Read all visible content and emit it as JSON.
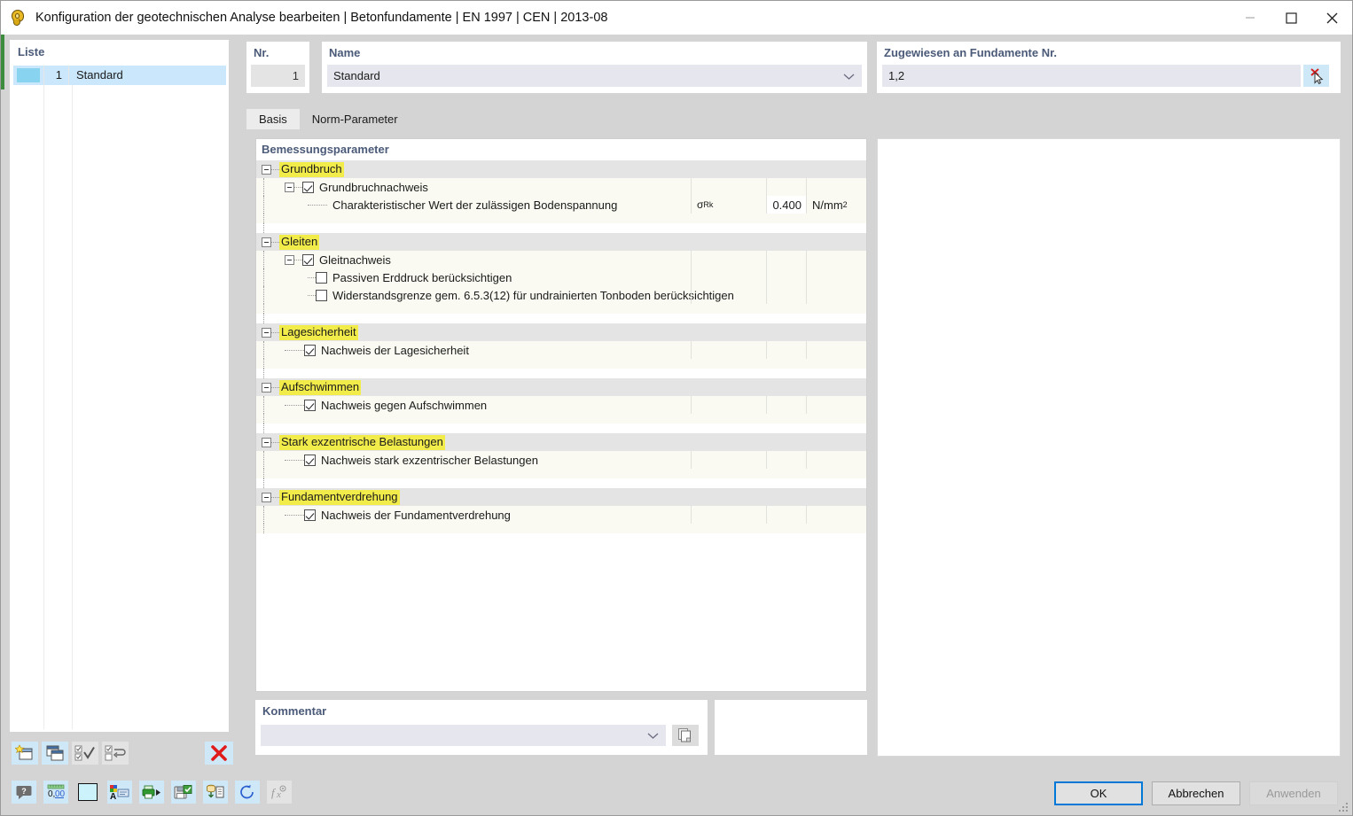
{
  "window": {
    "title": "Konfiguration der geotechnischen Analyse bearbeiten | Betonfundamente | EN 1997 | CEN | 2013-08",
    "icon": "pin-icon",
    "minimize": "minimize-icon",
    "maximize": "maximize-icon",
    "close": "close-icon"
  },
  "list_panel": {
    "label": "Liste",
    "rows": [
      {
        "number": "1",
        "name": "Standard",
        "color": "#87d3f0"
      }
    ],
    "toolbar": [
      {
        "name": "new-item-button",
        "icon": "new-window-star-icon"
      },
      {
        "name": "copy-item-button",
        "icon": "duplicate-window-icon"
      },
      {
        "name": "select-all-button",
        "icon": "check-all-icon"
      },
      {
        "name": "invert-selection-button",
        "icon": "toggle-selection-icon"
      },
      {
        "name": "delete-item-button",
        "icon": "red-x-icon"
      }
    ]
  },
  "fields": {
    "nr": {
      "label": "Nr.",
      "value": "1"
    },
    "name": {
      "label": "Name",
      "value": "Standard"
    },
    "assigned": {
      "label": "Zugewiesen an Fundamente Nr.",
      "value": "1,2",
      "button_icon": "pick-object-cursor-icon"
    }
  },
  "tabs": [
    {
      "label": "Basis",
      "active": true
    },
    {
      "label": "Norm-Parameter",
      "active": false
    }
  ],
  "tree": {
    "title": "Bemessungsparameter",
    "groups": [
      {
        "name": "Grundbruch",
        "rows": [
          {
            "kind": "check",
            "label": "Grundbruchnachweis",
            "checked": true,
            "expander": true,
            "symbol": "",
            "value": "",
            "unit": ""
          },
          {
            "kind": "value",
            "label": "Charakteristischer Wert der zulässigen Bodenspannung",
            "symbol_base": "σ",
            "symbol_sub": "Rk",
            "value": "0.400",
            "unit_base": "N/mm",
            "unit_sup": "2"
          }
        ]
      },
      {
        "name": "Gleiten",
        "rows": [
          {
            "kind": "check",
            "label": "Gleitnachweis",
            "checked": true,
            "expander": true
          },
          {
            "kind": "subcheck",
            "label": "Passiven Erddruck berücksichtigen",
            "checked": false
          },
          {
            "kind": "subcheck",
            "label": "Widerstandsgrenze gem. 6.5.3(12) für undrainierten Tonboden berücksichtigen",
            "checked": false
          }
        ]
      },
      {
        "name": "Lagesicherheit",
        "rows": [
          {
            "kind": "check",
            "label": "Nachweis der Lagesicherheit",
            "checked": true,
            "expander": false
          }
        ]
      },
      {
        "name": "Aufschwimmen",
        "rows": [
          {
            "kind": "check",
            "label": "Nachweis gegen Aufschwimmen",
            "checked": true,
            "expander": false
          }
        ]
      },
      {
        "name": "Stark exzentrische Belastungen",
        "rows": [
          {
            "kind": "check",
            "label": "Nachweis stark exzentrischer Belastungen",
            "checked": true,
            "expander": false
          }
        ]
      },
      {
        "name": "Fundamentverdrehung",
        "rows": [
          {
            "kind": "check",
            "label": "Nachweis der Fundamentverdrehung",
            "checked": true,
            "expander": false
          }
        ]
      }
    ]
  },
  "comment": {
    "label": "Kommentar",
    "value": "",
    "button_icon": "copy-pages-icon"
  },
  "status_toolbar": [
    {
      "name": "help-button",
      "icon": "help-bubble-icon"
    },
    {
      "name": "units-button",
      "icon": "decimal-places-icon"
    },
    {
      "name": "color-button",
      "icon": "color-swatch-icon"
    },
    {
      "name": "display-properties-button",
      "icon": "font-color-icon"
    },
    {
      "name": "print-button",
      "icon": "printer-icon"
    },
    {
      "name": "save-printreport-button",
      "icon": "save-report-icon"
    },
    {
      "name": "export-button",
      "icon": "export-data-icon"
    },
    {
      "name": "reset-button",
      "icon": "undo-circle-icon"
    },
    {
      "name": "formula-button",
      "icon": "function-icon"
    }
  ],
  "dialog_buttons": [
    {
      "label": "OK",
      "name": "ok-button",
      "state": "default"
    },
    {
      "label": "Abbrechen",
      "name": "cancel-button",
      "state": "normal"
    },
    {
      "label": "Anwenden",
      "name": "apply-button",
      "state": "disabled"
    }
  ],
  "colors": {
    "highlight": "#f2ec4b",
    "accent": "#0078d7",
    "label": "#4a5a78",
    "selection": "#cbe7fb"
  }
}
